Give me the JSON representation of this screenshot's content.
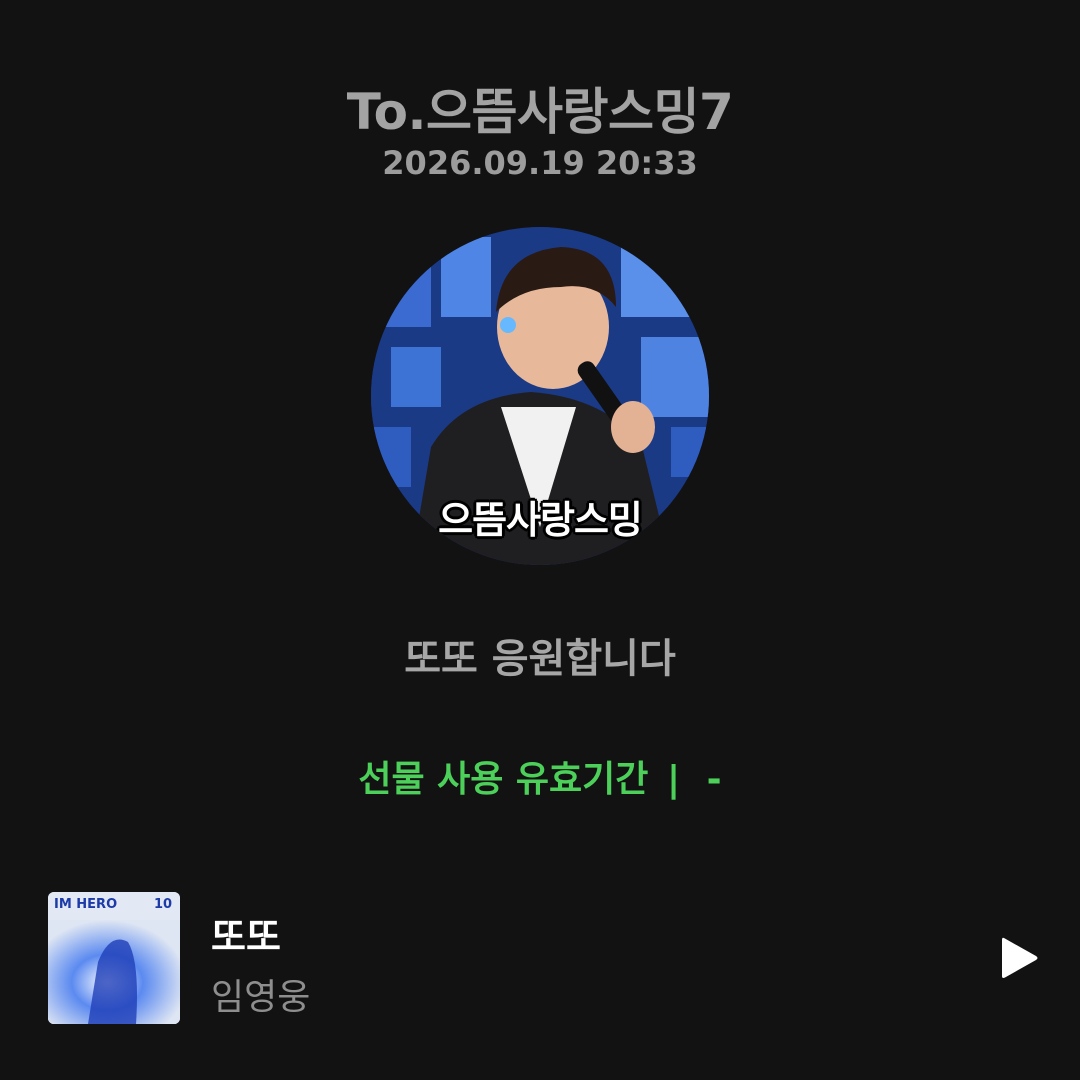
{
  "header": {
    "recipient": "To.으뜸사랑스밍7",
    "timestamp": "2026.09.19 20:33"
  },
  "profile": {
    "caption": "으뜸사랑스밍"
  },
  "message": {
    "text": "또또 응원합니다"
  },
  "gift": {
    "validity_label": "선물 사용 유효기간",
    "separator": "|",
    "validity_value": "-"
  },
  "track": {
    "title": "또또",
    "artist": "임영웅",
    "album_art_text": "IM HERO",
    "album_art_number": "10"
  },
  "icons": {
    "play": "play-icon"
  },
  "colors": {
    "background": "#121212",
    "accent_green": "#4cd05a",
    "title_gray": "#a3a3a3"
  }
}
